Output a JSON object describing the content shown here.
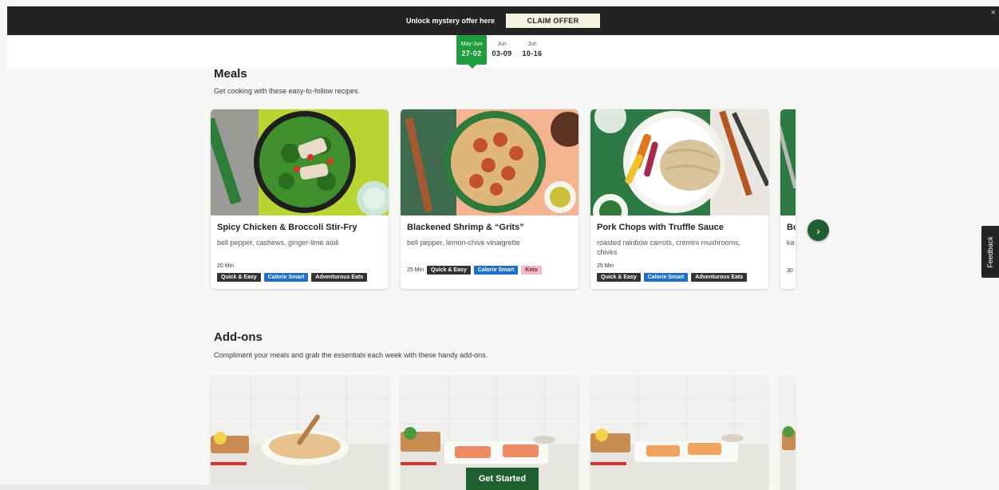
{
  "offer_bar": {
    "text": "Unlock mystery offer here",
    "claim_label": "CLAIM OFFER",
    "close_glyph": "×"
  },
  "weeks": [
    {
      "month": "May-Jun",
      "days": "27-02",
      "active": true
    },
    {
      "month": "Jun",
      "days": "03-09",
      "active": false
    },
    {
      "month": "Jun",
      "days": "10-16",
      "active": false
    }
  ],
  "meals": {
    "title": "Meals",
    "subtitle": "Get cooking with these easy-to-follow recipes.",
    "cards": [
      {
        "title": "Spicy Chicken & Broccoli Stir-Fry",
        "desc": "bell pepper, cashews, ginger-lime aïoli",
        "time": "20 Min",
        "tags": [
          {
            "label": "Quick & Easy",
            "style": "dark"
          },
          {
            "label": "Calorie Smart",
            "style": "blue"
          },
          {
            "label": "Adventurous Eats",
            "style": "dark"
          }
        ]
      },
      {
        "title": "Blackened Shrimp & “Grits”",
        "desc": "bell pepper, lemon-chive vinaigrette",
        "time": "25 Min",
        "tags": [
          {
            "label": "Quick & Easy",
            "style": "dark"
          },
          {
            "label": "Calorie Smart",
            "style": "blue"
          },
          {
            "label": "Keto",
            "style": "pink"
          }
        ]
      },
      {
        "title": "Pork Chops with Truffle Sauce",
        "desc": "roasted rainbow carrots, cremini mushrooms, chives",
        "time": "25 Min",
        "tags": [
          {
            "label": "Quick & Easy",
            "style": "dark"
          },
          {
            "label": "Calorie Smart",
            "style": "blue"
          },
          {
            "label": "Adventurous Eats",
            "style": "dark"
          }
        ]
      },
      {
        "title": "Bo",
        "desc": "ka",
        "time": "30 ",
        "tags": []
      }
    ]
  },
  "addons": {
    "title": "Add-ons",
    "subtitle": "Compliment your meals and grab the essentials each week with these handy add-ons."
  },
  "next_glyph": "›",
  "feedback_label": "Feedback",
  "get_started_label": "Get Started",
  "icons": {
    "close": "close-icon",
    "next": "chevron-right-icon"
  },
  "colors": {
    "brand_green": "#1f9c3e",
    "dark_green": "#1f5e2f",
    "tag_blue": "#1c6fd1",
    "tag_pink": "#f4b9c4",
    "tag_dark": "#333333"
  }
}
